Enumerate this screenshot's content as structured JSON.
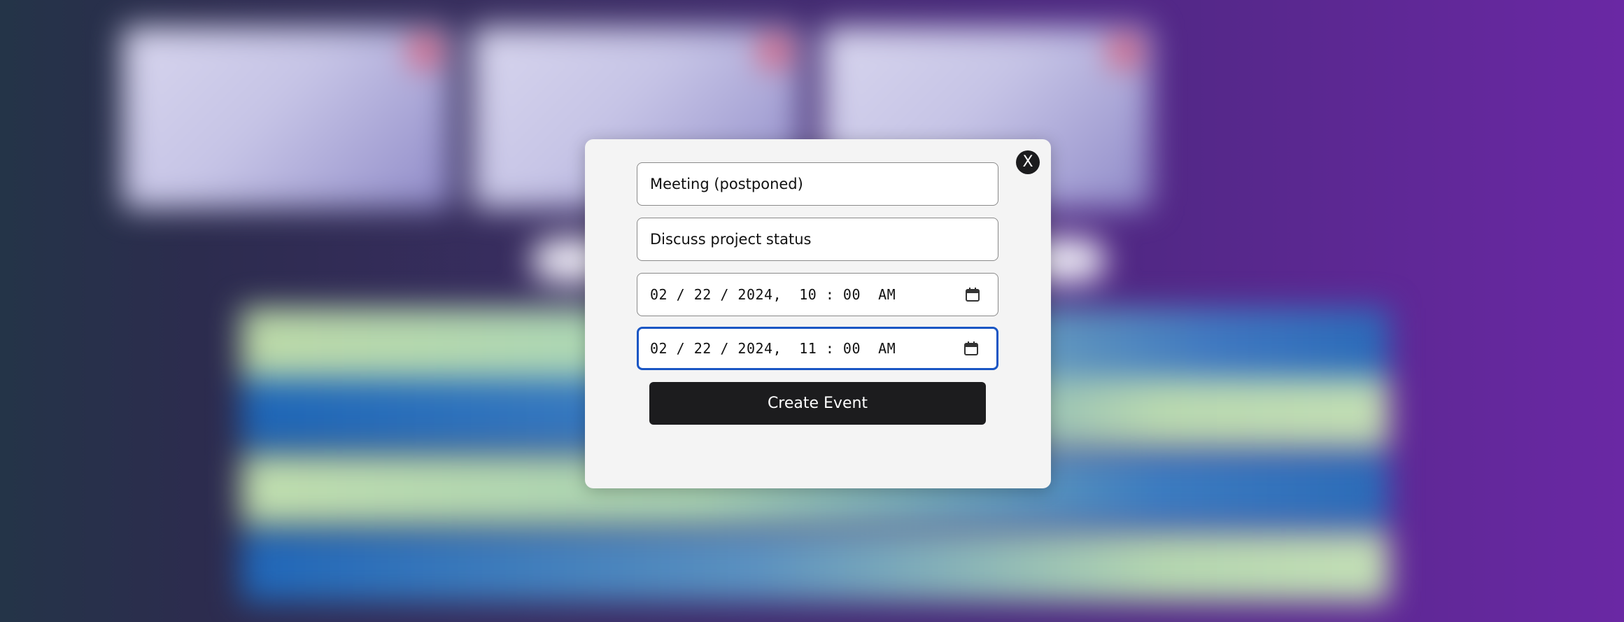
{
  "modal": {
    "close_label": "X",
    "title_value": "Meeting (postponed)",
    "description_value": "Discuss project status",
    "start": {
      "date": "02 / 22 / 2024",
      "sep": ",",
      "time": "10 : 00",
      "ampm": "AM"
    },
    "end": {
      "date": "02 / 22 / 2024",
      "sep": ",",
      "time": "11 : 00",
      "ampm": "AM"
    },
    "create_label": "Create Event"
  },
  "icons": {
    "close": "close-icon",
    "calendar": "calendar-icon"
  },
  "colors": {
    "modal_bg": "#f4f4f4",
    "button_bg": "#1c1c1e",
    "focus_border": "#1a56c4"
  }
}
